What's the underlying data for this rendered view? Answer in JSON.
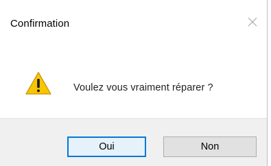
{
  "window": {
    "title": "Confirmation",
    "close_icon": "close-icon"
  },
  "message": {
    "icon": "warning-icon",
    "text": "Voulez vous vraiment réparer ?"
  },
  "buttons": {
    "yes_label": "Oui",
    "no_label": "Non"
  },
  "colors": {
    "warning_fill": "#f7c600",
    "focus_border": "#0078d7",
    "footer_bg": "#f0f0f0"
  }
}
